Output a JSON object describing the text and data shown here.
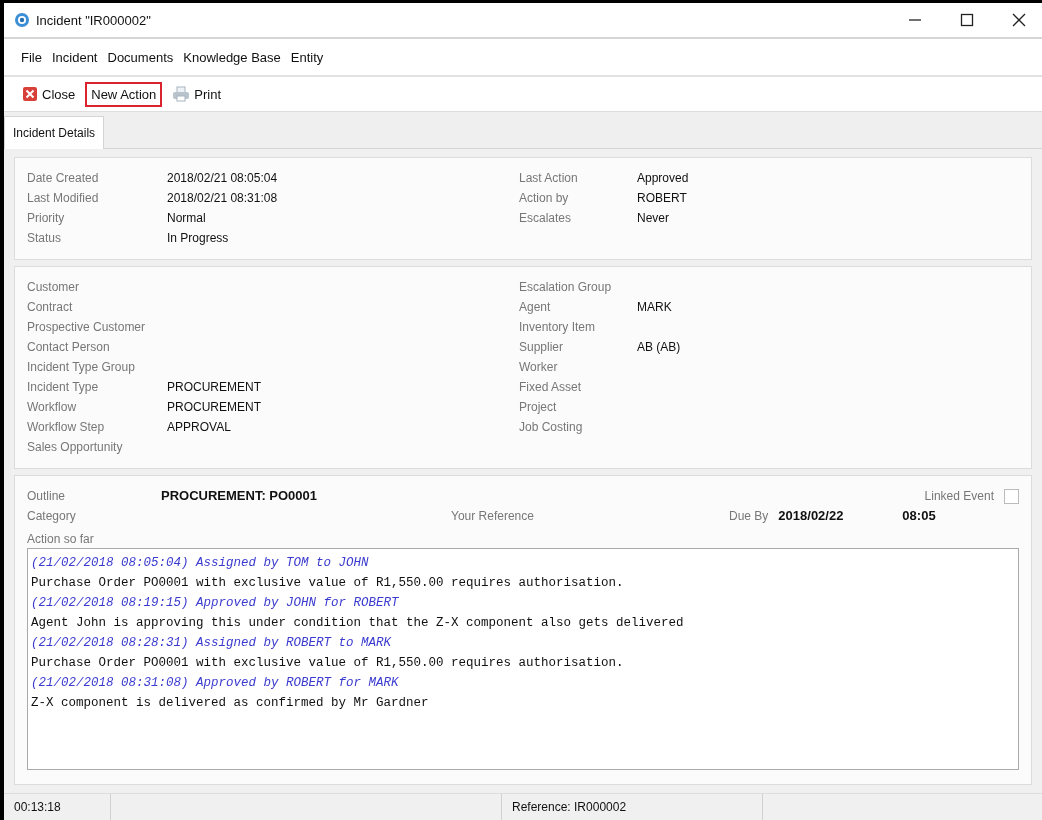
{
  "window": {
    "title": "Incident \"IR000002\""
  },
  "menu": [
    "File",
    "Incident",
    "Documents",
    "Knowledge Base",
    "Entity"
  ],
  "toolbar": [
    {
      "kind": "close",
      "label": "Close",
      "selected": false
    },
    {
      "kind": "plain",
      "label": "New Action",
      "selected": true
    },
    {
      "kind": "print",
      "label": "Print",
      "selected": false
    }
  ],
  "tabs": [
    {
      "label": "Incident Details",
      "selected": true
    }
  ],
  "summary": {
    "left": [
      {
        "label": "Date Created",
        "value": "2018/02/21 08:05:04"
      },
      {
        "label": "Last Modified",
        "value": "2018/02/21 08:31:08"
      },
      {
        "label": "Priority",
        "value": "Normal"
      },
      {
        "label": "Status",
        "value": "In Progress"
      }
    ],
    "right": [
      {
        "label": "Last Action",
        "value": "Approved"
      },
      {
        "label": "Action by",
        "value": "ROBERT"
      },
      {
        "label": "Escalates",
        "value": "Never"
      }
    ]
  },
  "links": {
    "left": [
      {
        "label": "Customer"
      },
      {
        "label": "Contract"
      },
      {
        "label": "Prospective Customer"
      },
      {
        "label": "Contact Person"
      },
      {
        "label": "Incident Type Group"
      },
      {
        "label": "Incident Type",
        "value": "PROCUREMENT"
      },
      {
        "label": "Workflow",
        "value": "PROCUREMENT"
      },
      {
        "label": "Workflow Step",
        "value": "APPROVAL"
      },
      {
        "label": "Sales Opportunity"
      }
    ],
    "right": [
      {
        "label": "Escalation Group"
      },
      {
        "label": "Agent",
        "value": "MARK"
      },
      {
        "label": "Inventory Item"
      },
      {
        "label": "Supplier",
        "value": "AB (AB)"
      },
      {
        "label": "Worker"
      },
      {
        "label": "Fixed Asset"
      },
      {
        "label": "Project"
      },
      {
        "label": "Job Costing"
      }
    ]
  },
  "detail": {
    "outline_label": "Outline",
    "outline": "PROCUREMENT: PO0001",
    "linked_event_label": "Linked Event",
    "linked_event_checked": false,
    "category_label": "Category",
    "your_reference_label": "Your Reference",
    "due_by_label": "Due By",
    "due_date": "2018/02/22",
    "due_time": "08:05",
    "action_label": "Action so far",
    "log": [
      {
        "kind": "header",
        "text": "(21/02/2018 08:05:04) Assigned by TOM to JOHN"
      },
      {
        "kind": "text",
        "text": "Purchase Order PO0001 with exclusive value of R1,550.00 requires authorisation."
      },
      {
        "kind": "header",
        "text": "(21/02/2018 08:19:15) Approved by JOHN for ROBERT"
      },
      {
        "kind": "text",
        "text": "Agent John is approving this under condition that the Z-X component also gets delivered"
      },
      {
        "kind": "header",
        "text": "(21/02/2018 08:28:31) Assigned by ROBERT to MARK"
      },
      {
        "kind": "text",
        "text": "Purchase Order PO0001 with exclusive value of R1,550.00 requires authorisation."
      },
      {
        "kind": "header",
        "text": "(21/02/2018 08:31:08) Approved by ROBERT for MARK"
      },
      {
        "kind": "text",
        "text": "Z-X component is delivered as confirmed by Mr Gardner"
      }
    ]
  },
  "status_bar": {
    "timer": "00:13:18",
    "reference": "Reference: IR000002"
  }
}
